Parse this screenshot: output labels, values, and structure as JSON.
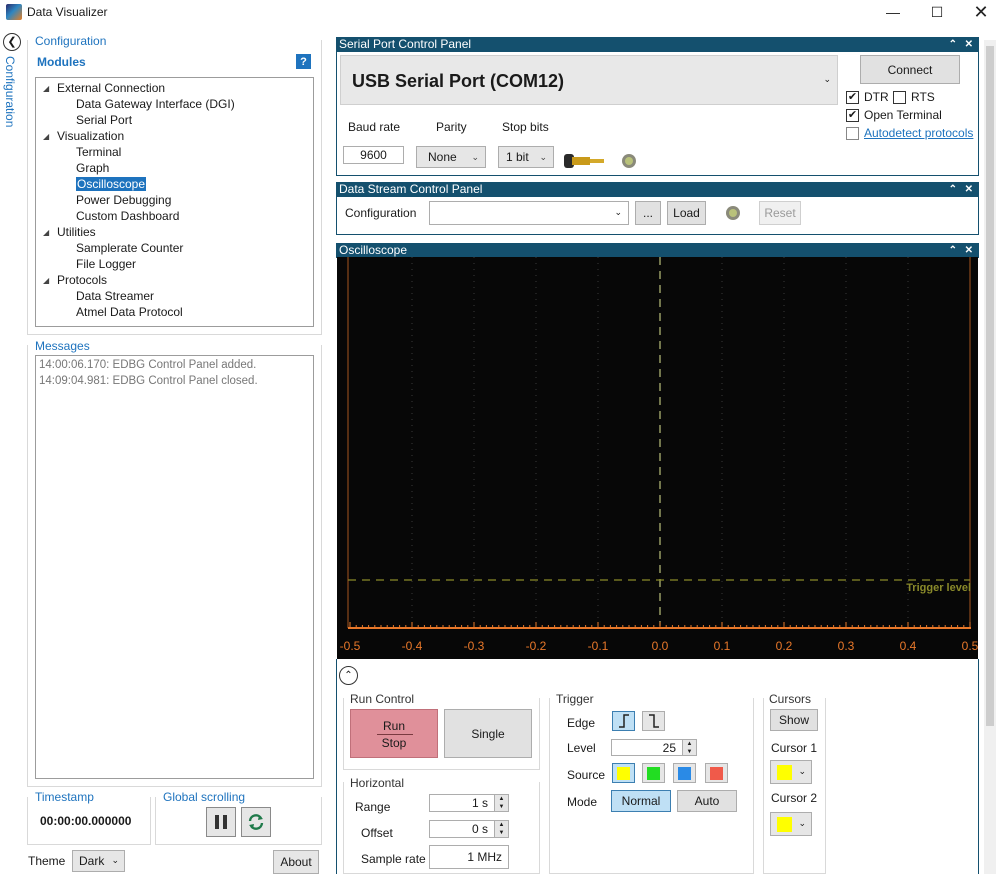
{
  "window": {
    "title": "Data Visualizer"
  },
  "sidebar": {
    "vertical_label": "Configuration"
  },
  "configuration": {
    "title": "Configuration",
    "modules_title": "Modules",
    "help": "?",
    "tree": [
      {
        "label": "External Connection",
        "level": 0
      },
      {
        "label": "Data Gateway Interface (DGI)",
        "level": 1
      },
      {
        "label": "Serial Port",
        "level": 1
      },
      {
        "label": "Visualization",
        "level": 0
      },
      {
        "label": "Terminal",
        "level": 1
      },
      {
        "label": "Graph",
        "level": 1
      },
      {
        "label": "Oscilloscope",
        "level": 1,
        "selected": true
      },
      {
        "label": "Power Debugging",
        "level": 1
      },
      {
        "label": "Custom Dashboard",
        "level": 1
      },
      {
        "label": "Utilities",
        "level": 0
      },
      {
        "label": "Samplerate Counter",
        "level": 1
      },
      {
        "label": "File Logger",
        "level": 1
      },
      {
        "label": "Protocols",
        "level": 0
      },
      {
        "label": "Data Streamer",
        "level": 1
      },
      {
        "label": "Atmel Data Protocol",
        "level": 1
      }
    ]
  },
  "messages": {
    "title": "Messages",
    "items": [
      "14:00:06.170: EDBG Control Panel added.",
      "14:09:04.981: EDBG Control Panel closed."
    ]
  },
  "timestamp": {
    "title": "Timestamp",
    "value": "00:00:00.000000"
  },
  "global_scrolling": {
    "title": "Global scrolling"
  },
  "theme": {
    "label": "Theme",
    "value": "Dark"
  },
  "about": "About",
  "serial_panel": {
    "title": "Serial Port Control Panel",
    "port": "USB Serial Port (COM12)",
    "connect": "Connect",
    "dtr_label": "DTR",
    "dtr_checked": true,
    "rts_label": "RTS",
    "rts_checked": false,
    "open_terminal_label": "Open Terminal",
    "open_terminal_checked": true,
    "autodetect_label": "Autodetect protocols",
    "autodetect_checked": false,
    "baud_label": "Baud rate",
    "baud_value": "9600",
    "parity_label": "Parity",
    "parity_value": "None",
    "stopbits_label": "Stop bits",
    "stopbits_value": "1 bit"
  },
  "stream_panel": {
    "title": "Data Stream Control Panel",
    "config_label": "Configuration",
    "config_value": "",
    "browse": "...",
    "load": "Load",
    "reset": "Reset"
  },
  "oscilloscope": {
    "title": "Oscilloscope",
    "trigger_level_label": "Trigger level",
    "x_ticks": [
      "-0.5",
      "-0.4",
      "-0.3",
      "-0.2",
      "-0.1",
      "0.0",
      "0.1",
      "0.2",
      "0.3",
      "0.4",
      "0.5"
    ],
    "colors": {
      "background": "#070707",
      "axis": "#e8782a",
      "trigger": "#8a8a2a",
      "grid": "#3a3a3a"
    }
  },
  "run_control": {
    "title": "Run Control",
    "run_label": "Run",
    "stop_label": "Stop",
    "single": "Single"
  },
  "horizontal": {
    "title": "Horizontal",
    "range_label": "Range",
    "range_value": "1 s",
    "offset_label": "Offset",
    "offset_value": "0 s",
    "samplerate_label": "Sample rate",
    "samplerate_value": "1 MHz"
  },
  "trigger": {
    "title": "Trigger",
    "edge_label": "Edge",
    "level_label": "Level",
    "level_value": "25",
    "source_label": "Source",
    "source_colors": [
      "#ffff00",
      "#22dd22",
      "#2a8ae6",
      "#f05a4a"
    ],
    "mode_label": "Mode",
    "mode_normal": "Normal",
    "mode_auto": "Auto"
  },
  "cursors": {
    "title": "Cursors",
    "show": "Show",
    "cursor1_label": "Cursor 1",
    "cursor2_label": "Cursor 2",
    "cursor_color": "#ffff00"
  }
}
